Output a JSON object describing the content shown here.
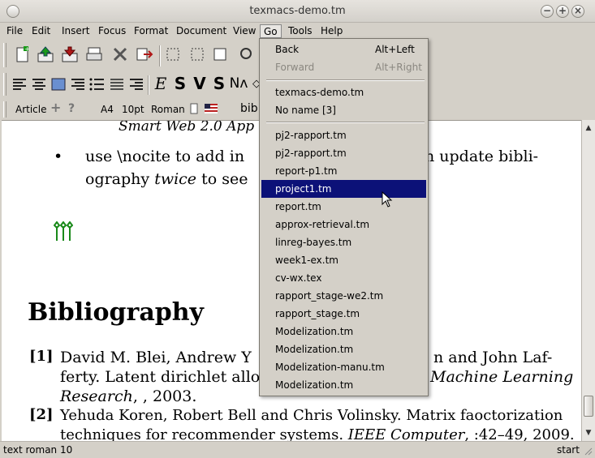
{
  "window": {
    "title": "texmacs-demo.tm"
  },
  "menubar": {
    "items": [
      "File",
      "Edit",
      "Insert",
      "Focus",
      "Format",
      "Document",
      "View",
      "Go",
      "Tools",
      "Help"
    ]
  },
  "format_bar": {
    "style": "Article",
    "plus": "+",
    "help": "?",
    "paper": "A4",
    "size": "10pt",
    "font": "Roman",
    "field_text": "bib"
  },
  "document": {
    "top_line": "Smart Web 2.0 App",
    "bullet_line1": "use \\nocite to add in",
    "bullet_line1_end": "n update bibli-",
    "bullet_line2_a": "ography ",
    "bullet_line2_twice": "twice",
    "bullet_line2_b": " to see",
    "bib_title": "Bibliography",
    "ref1_num": "[1]",
    "ref1_line1_a": "David M. Blei, Andrew Y",
    "ref1_line1_b": "n and John Laf-",
    "ref1_line2_a": "ferty. Latent dirichlet alloca",
    "ref1_line2_b": "Machine Learning",
    "ref1_line3_a": "Research",
    "ref1_line3_b": ", , 2003.",
    "ref2_num": "[2]",
    "ref2_line1": "Yehuda Koren, Robert Bell and Chris Volinsky. Matrix faoctorization",
    "ref2_line2_a": "techniques for recommender systems. ",
    "ref2_line2_b": "IEEE Computer",
    "ref2_line2_c": ", :42–49, 2009."
  },
  "status": {
    "left": "text roman 10",
    "right": "start"
  },
  "go_menu": {
    "back": {
      "label": "Back",
      "shortcut": "Alt+Left"
    },
    "forward": {
      "label": "Forward",
      "shortcut": "Alt+Right"
    },
    "open": [
      "texmacs-demo.tm",
      "No name [3]"
    ],
    "recent": [
      "pj2-rapport.tm",
      "pj2-rapport.tm",
      "report-p1.tm",
      "project1.tm",
      "report.tm",
      "approx-retrieval.tm",
      "linreg-bayes.tm",
      "week1-ex.tm",
      "cv-wx.tex",
      "rapport_stage-we2.tm",
      "rapport_stage.tm",
      "Modelization.tm",
      "Modelization.tm",
      "Modelization-manu.tm",
      "Modelization.tm"
    ]
  },
  "colors": {
    "selection": "#0c1178",
    "menu_bg": "#d4d0c8",
    "page": "#ffffff"
  }
}
